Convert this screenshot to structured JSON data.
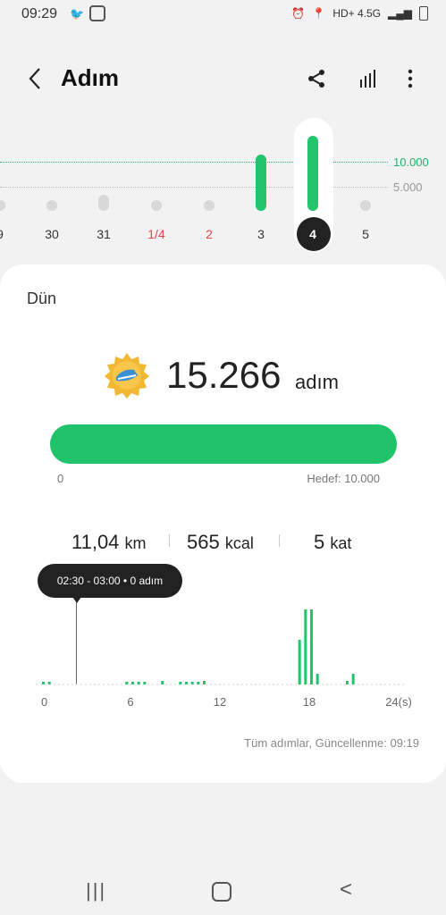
{
  "status_bar": {
    "time": "09:29",
    "network": "HD+ 4.5G"
  },
  "header": {
    "title": "Adım"
  },
  "weekly": {
    "axis_top": "10.000",
    "axis_mid": "5.000",
    "days": [
      {
        "label": "9",
        "value": 800,
        "weekend": false
      },
      {
        "label": "30",
        "value": 1200,
        "weekend": false
      },
      {
        "label": "31",
        "value": 3200,
        "weekend": false
      },
      {
        "label": "1/4",
        "value": 300,
        "weekend": true
      },
      {
        "label": "2",
        "value": 300,
        "weekend": true
      },
      {
        "label": "3",
        "value": 11500,
        "weekend": false
      },
      {
        "label": "4",
        "value": 15266,
        "weekend": false,
        "selected": true
      },
      {
        "label": "5",
        "value": 300,
        "weekend": false
      }
    ],
    "colors": {
      "goal": "#1db56b",
      "active": "#22c56c",
      "inactive": "#d8d8d8",
      "weekend_label": "#e04848"
    }
  },
  "card": {
    "day_label": "Dün",
    "steps": "15.266",
    "steps_unit": "adım",
    "progress_start": "0",
    "goal_text": "Hedef: 10.000",
    "progress_fraction": 1.0,
    "distance": "11,04",
    "distance_unit": "km",
    "calories": "565",
    "calories_unit": "kcal",
    "floors": "5",
    "floors_unit": "kat",
    "tooltip": "02:30 - 03:00 • 0 adım",
    "updated": "Tüm adımlar, Güncellenme: 09:19"
  },
  "chart_data": {
    "type": "bar",
    "x": [
      0,
      0.5,
      1,
      1.5,
      2,
      2.5,
      3,
      3.5,
      4,
      4.5,
      5,
      5.5,
      6,
      6.5,
      7,
      7.5,
      8,
      8.5,
      9,
      9.5,
      10,
      10.5,
      11,
      11.5,
      12,
      12.5,
      13,
      13.5,
      14,
      14.5,
      15,
      15.5,
      16,
      16.5,
      17,
      17.5,
      18,
      18.5,
      19,
      19.5,
      20,
      20.5,
      21,
      21.5,
      22,
      22.5,
      23,
      23.5
    ],
    "values": [
      10,
      10,
      0,
      0,
      0,
      0,
      0,
      0,
      0,
      0,
      0,
      0,
      0,
      0,
      10,
      10,
      10,
      10,
      0,
      0,
      20,
      0,
      0,
      10,
      10,
      10,
      10,
      20,
      0,
      0,
      0,
      0,
      0,
      0,
      0,
      0,
      0,
      0,
      0,
      0,
      0,
      0,
      0,
      250,
      420,
      420,
      60,
      0,
      0,
      0,
      0,
      20,
      60,
      0,
      0,
      0,
      0,
      0,
      0,
      0
    ],
    "xticks": [
      "0",
      "6",
      "12",
      "18",
      "24(s)"
    ],
    "xlim": [
      0,
      24
    ],
    "color": "#22c56c"
  },
  "nav": {
    "recent": "|||",
    "home": "○",
    "back": "<"
  }
}
